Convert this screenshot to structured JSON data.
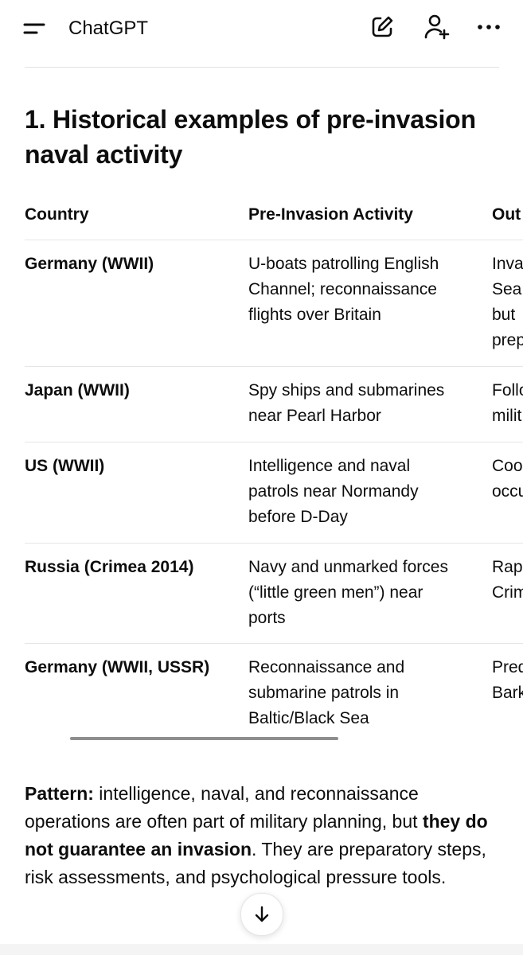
{
  "header": {
    "title": "ChatGPT",
    "menu_icon": "sidebar-menu-icon",
    "new_chat_icon": "compose-icon",
    "add_people_icon": "add-person-icon",
    "more_icon": "more-horizontal-icon"
  },
  "section": {
    "heading": "1. Historical examples of pre-invasion naval activity"
  },
  "table": {
    "headers": [
      "Country",
      "Pre-Invasion Activity",
      "Out"
    ],
    "rows": [
      {
        "country": "Germany (WWII)",
        "activity": "U-boats patrolling English\nChannel; reconnaissance\nflights over Britain",
        "outcome": "Inva\nSea\nbut\nprep"
      },
      {
        "country": "Japan (WWII)",
        "activity": "Spy ships and submarines\nnear Pearl Harbor",
        "outcome": "Follo\nmilit"
      },
      {
        "country": "US (WWII)",
        "activity": "Intelligence and naval\npatrols near Normandy\nbefore D-Day",
        "outcome": "Coo\noccu"
      },
      {
        "country": "Russia (Crimea 2014)",
        "activity": "Navy and unmarked forces\n(“little green men”) near\nports",
        "outcome": "Rap\nCrim"
      },
      {
        "country": "Germany (WWII, USSR)",
        "activity": "Reconnaissance and\nsubmarine patrols in\nBaltic/Black Sea",
        "outcome": "Pred\nBark"
      }
    ]
  },
  "paragraph": {
    "label": "Pattern:",
    "text1": " intelligence, naval, and reconnaissance operations are often part of military planning, but ",
    "bold": "they do not guarantee an invasion",
    "text2": ". They are preparatory steps, risk assessments, and psychological pressure tools."
  },
  "scroll_button_icon": "arrow-down-icon"
}
